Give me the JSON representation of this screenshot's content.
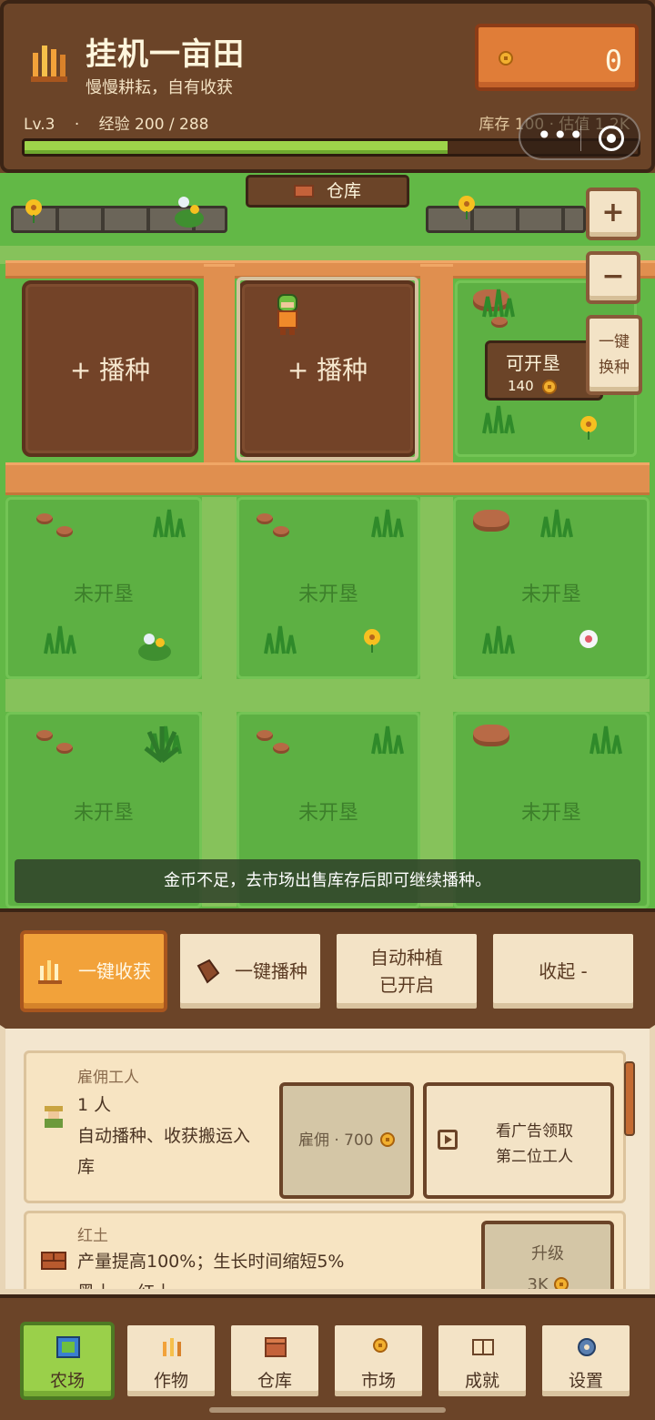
{
  "header": {
    "title": "挂机一亩田",
    "subtitle": "慢慢耕耘，自有收获",
    "coins": "0",
    "level": "Lv.3",
    "level_sep": "·",
    "xp_text": "经验 200 / 288",
    "xp_progress": 0.69,
    "stock_text": "库存 100 · 估值 1.2K"
  },
  "farm": {
    "store_button": "仓库",
    "zoom_in": "+",
    "zoom_out": "−",
    "swap_button_line1": "一键",
    "swap_button_line2": "换种",
    "reclaim_title": "可开垦",
    "reclaim_cost": "140",
    "plots": [
      {
        "label": "+ 播种",
        "state": "empty"
      },
      {
        "label": "+ 播种",
        "state": "empty-selected"
      },
      {
        "label": "未开垦",
        "state": "locked"
      },
      {
        "label": "未开垦",
        "state": "locked"
      },
      {
        "label": "未开垦",
        "state": "locked"
      },
      {
        "label": "未开垦",
        "state": "locked"
      },
      {
        "label": "未开垦",
        "state": "locked"
      },
      {
        "label": "未开垦",
        "state": "locked"
      }
    ],
    "toast": "金币不足，去市场出售库存后即可继续播种。"
  },
  "actions": {
    "harvest": "一键收获",
    "sow": "一键播种",
    "auto_line1": "自动种植",
    "auto_line2": "已开启",
    "collapse": "收起 -"
  },
  "panel": {
    "worker": {
      "name": "雇佣工人",
      "count": "1 人",
      "desc_line1": "自动播种、收获搬运入",
      "desc_line2": "库",
      "hire_label": "雇佣 · 700",
      "ad_line1": "看广告领取",
      "ad_line2": "第二位工人"
    },
    "soil": {
      "name": "红土",
      "desc": "产量提高100%；生长时间缩短5%",
      "desc2": "黑土 → 红土",
      "upgrade_label": "升级",
      "upgrade_cost": "3K"
    }
  },
  "nav": {
    "items": [
      "农场",
      "作物",
      "仓库",
      "市场",
      "成就",
      "设置"
    ],
    "active": "农场"
  },
  "colors": {
    "wood": "#6b4428",
    "grass": "#62b846",
    "path": "#e08f4f",
    "accent": "#f2a23a",
    "nav_active": "#9ad04a"
  }
}
